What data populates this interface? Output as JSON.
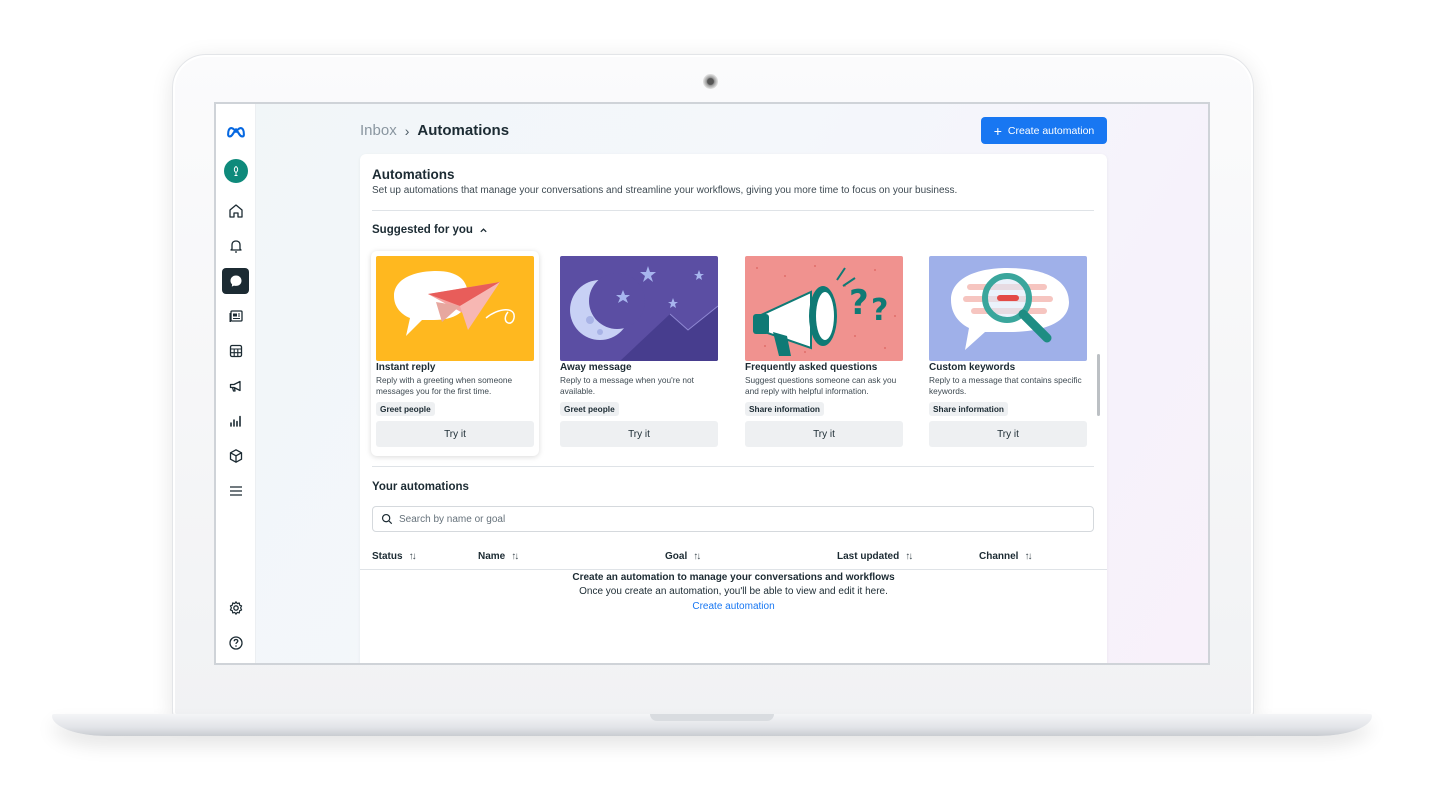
{
  "header": {
    "breadcrumb_parent": "Inbox",
    "breadcrumb_separator": "›",
    "breadcrumb_current": "Automations",
    "create_button_label": "Create automation"
  },
  "panel": {
    "title": "Automations",
    "description": "Set up automations that manage your conversations and streamline your workflows, giving you more time to focus on your business."
  },
  "suggested": {
    "heading": "Suggested for you",
    "cards": [
      {
        "title": "Instant reply",
        "description": "Reply with a greeting when someone messages you for the first time.",
        "tag": "Greet people",
        "button": "Try it"
      },
      {
        "title": "Away message",
        "description": "Reply to a message when you're not available.",
        "tag": "Greet people",
        "button": "Try it"
      },
      {
        "title": "Frequently asked questions",
        "description": "Suggest questions someone can ask you and reply with helpful information.",
        "tag": "Share information",
        "button": "Try it"
      },
      {
        "title": "Custom keywords",
        "description": "Reply to a message that contains specific keywords.",
        "tag": "Share information",
        "button": "Try it"
      }
    ]
  },
  "your_automations": {
    "heading": "Your automations",
    "search_placeholder": "Search by name or goal",
    "columns": [
      "Status",
      "Name",
      "Goal",
      "Last updated",
      "Channel"
    ],
    "empty_title": "Create an automation to manage your conversations and workflows",
    "empty_description": "Once you create an automation, you'll be able to view and edit it here.",
    "empty_link": "Create automation"
  },
  "sidebar": {
    "icons": [
      "meta-logo-icon",
      "avatar",
      "home-icon",
      "bell-icon",
      "chat-icon",
      "posts-icon",
      "table-icon",
      "megaphone-icon",
      "insights-icon",
      "box-icon",
      "menu-icon",
      "settings-icon",
      "help-icon"
    ]
  },
  "colors": {
    "accent": "#1877f2",
    "text": "#1c2b33",
    "instant_reply_bg": "#ffb81f",
    "away_bg": "#5b4ea3",
    "faq_bg": "#f0928f",
    "keywords_bg": "#9fb0e9"
  }
}
